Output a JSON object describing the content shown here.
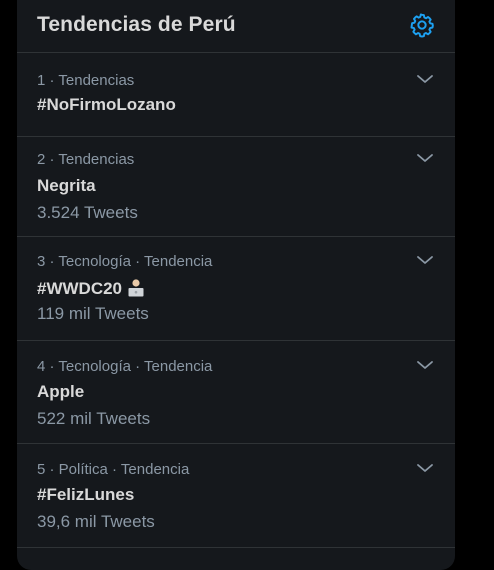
{
  "header": {
    "title": "Tendencias de Perú"
  },
  "trends": [
    {
      "rank": "1",
      "meta": "1 · Tendencias",
      "name": "#NoFirmoLozano",
      "count": ""
    },
    {
      "rank": "2",
      "meta": "2 · Tendencias",
      "name": "Negrita",
      "count": "3.524 Tweets"
    },
    {
      "rank": "3",
      "meta": "3 · Tecnología · Tendencia",
      "name": "#WWDC20",
      "count": "119 mil Tweets",
      "icon": "laptop-emoji-icon"
    },
    {
      "rank": "4",
      "meta": "4 · Tecnología · Tendencia",
      "name": "Apple",
      "count": "522 mil Tweets"
    },
    {
      "rank": "5",
      "meta": "5 · Política · Tendencia",
      "name": "#FelizLunes",
      "count": "39,6 mil Tweets"
    }
  ],
  "colors": {
    "background": "#000000",
    "panel": "#15181c",
    "divider": "#2f3336",
    "primary_text": "#d9d9d9",
    "secondary_text": "#8b98a5",
    "accent": "#1da1f2"
  }
}
